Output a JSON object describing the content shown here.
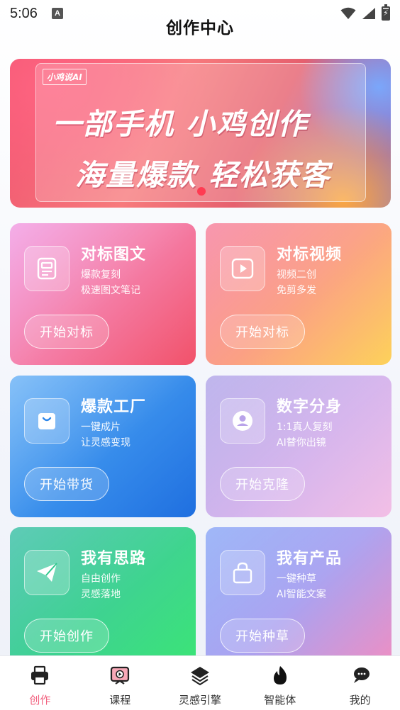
{
  "status_bar": {
    "time": "5:06",
    "notification_badge": "A"
  },
  "header": {
    "title": "创作中心"
  },
  "banner": {
    "logo": "小鸡说AI",
    "line1": "一部手机 小鸡创作",
    "line2": "海量爆款 轻松获客"
  },
  "cards": [
    {
      "title": "对标图文",
      "sub1": "爆款复刻",
      "sub2": "极速图文笔记",
      "button": "开始对标",
      "icon": "document-icon"
    },
    {
      "title": "对标视频",
      "sub1": "视频二创",
      "sub2": "免剪多发",
      "button": "开始对标",
      "icon": "play-icon"
    },
    {
      "title": "爆款工厂",
      "sub1": "一键成片",
      "sub2": "让灵感变现",
      "button": "开始带货",
      "icon": "shopping-bag-icon"
    },
    {
      "title": "数字分身",
      "sub1": "1:1真人复刻",
      "sub2": "AI替你出镜",
      "button": "开始克隆",
      "icon": "user-avatar-icon"
    },
    {
      "title": "我有思路",
      "sub1": "自由创作",
      "sub2": "灵感落地",
      "button": "开始创作",
      "icon": "paper-plane-icon"
    },
    {
      "title": "我有产品",
      "sub1": "一键种草",
      "sub2": "AI智能文案",
      "button": "开始种草",
      "icon": "lock-bag-icon"
    }
  ],
  "bottom_nav": [
    {
      "label": "创作",
      "icon": "printer-icon",
      "active": true
    },
    {
      "label": "课程",
      "icon": "video-course-icon",
      "active": false
    },
    {
      "label": "灵感引擎",
      "icon": "layers-icon",
      "active": false
    },
    {
      "label": "智能体",
      "icon": "flame-icon",
      "active": false
    },
    {
      "label": "我的",
      "icon": "chat-bubbles-icon",
      "active": false
    }
  ],
  "colors": {
    "accent": "#f2607e",
    "nav_text": "#333333"
  }
}
